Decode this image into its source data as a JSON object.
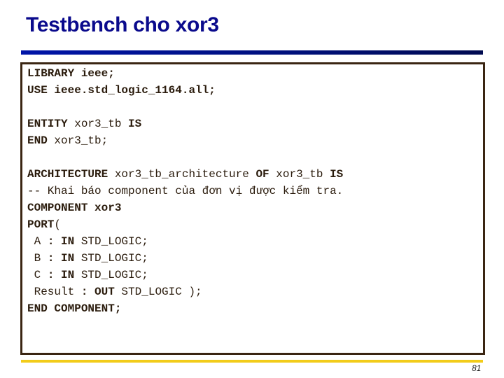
{
  "slide": {
    "title": "Testbench cho xor3",
    "page_number": "81",
    "colors": {
      "title": "#0a0a8c",
      "title_bar_start": "#0014a8",
      "title_bar_end": "#000a50",
      "code_border": "#3a2512",
      "code_text": "#2a1b0c",
      "footer_bar": "#f2cc1a"
    }
  },
  "code": {
    "lines": [
      [
        {
          "t": "LIBRARY ieee;",
          "b": true
        }
      ],
      [
        {
          "t": "USE ieee.std_logic_1164.all;",
          "b": true
        }
      ],
      [],
      [
        {
          "t": "ENTITY",
          "b": true
        },
        {
          "t": " xor3_tb ",
          "b": false
        },
        {
          "t": "IS",
          "b": true
        }
      ],
      [
        {
          "t": "END",
          "b": true
        },
        {
          "t": " xor3_tb;",
          "b": false
        }
      ],
      [],
      [
        {
          "t": "ARCHITECTURE",
          "b": true
        },
        {
          "t": " xor3_tb_architecture ",
          "b": false
        },
        {
          "t": "OF",
          "b": true
        },
        {
          "t": " xor3_tb ",
          "b": false
        },
        {
          "t": "IS",
          "b": true
        }
      ],
      [
        {
          "t": "-- Khai báo component của đơn vị được kiểm tra.",
          "b": false
        }
      ],
      [
        {
          "t": "COMPONENT xor3",
          "b": true
        }
      ],
      [
        {
          "t": "PORT",
          "b": true
        },
        {
          "t": "(",
          "b": false
        }
      ],
      [
        {
          "t": " A ",
          "b": false
        },
        {
          "t": ": IN",
          "b": true
        },
        {
          "t": " STD_LOGIC;",
          "b": false
        }
      ],
      [
        {
          "t": " B ",
          "b": false
        },
        {
          "t": ": IN",
          "b": true
        },
        {
          "t": " STD_LOGIC;",
          "b": false
        }
      ],
      [
        {
          "t": " C ",
          "b": false
        },
        {
          "t": ": IN",
          "b": true
        },
        {
          "t": " STD_LOGIC;",
          "b": false
        }
      ],
      [
        {
          "t": " Result ",
          "b": false
        },
        {
          "t": ": OUT",
          "b": true
        },
        {
          "t": " STD_LOGIC );",
          "b": false
        }
      ],
      [
        {
          "t": "END COMPONENT;",
          "b": true
        }
      ]
    ]
  }
}
